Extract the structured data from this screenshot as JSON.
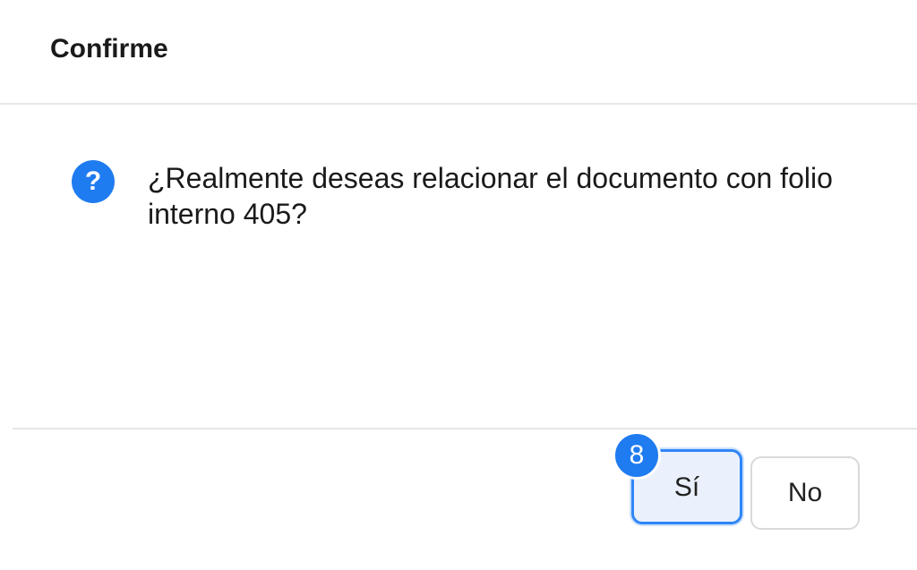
{
  "dialog": {
    "title": "Confirme",
    "message": "¿Realmente deseas relacionar el documento con folio interno 405?",
    "icon": {
      "name": "question-icon",
      "glyph": "?",
      "color": "#1f7bf0"
    },
    "buttons": {
      "yes_label": "Sí",
      "no_label": "No"
    },
    "step_badge": "8"
  },
  "colors": {
    "accent": "#1f7bf0",
    "focused_button_border": "#2f86f6",
    "focused_button_bg": "#eaf1fd"
  }
}
